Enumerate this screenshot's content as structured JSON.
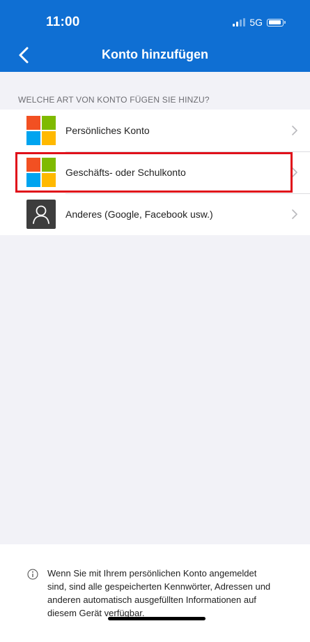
{
  "status_bar": {
    "time": "11:00",
    "network": "5G"
  },
  "nav": {
    "title": "Konto hinzufügen"
  },
  "section": {
    "header": "WELCHE ART VON KONTO FÜGEN SIE HINZU?"
  },
  "accounts": [
    {
      "label": "Persönliches Konto",
      "icon": "microsoft-logo"
    },
    {
      "label": "Geschäfts- oder Schulkonto",
      "icon": "microsoft-logo"
    },
    {
      "label": "Anderes (Google, Facebook usw.)",
      "icon": "person-icon"
    }
  ],
  "footer": {
    "info_text": "Wenn Sie mit Ihrem persönlichen Konto angemeldet sind, sind alle gespeicherten Kennwörter, Adressen und anderen automatisch ausgefüllten Informationen auf diesem Gerät verfügbar."
  },
  "colors": {
    "header_bg": "#0f6fd3",
    "highlight": "#e0101a",
    "ms_red": "#f25022",
    "ms_green": "#7fba00",
    "ms_blue": "#00a4ef",
    "ms_yellow": "#ffb900"
  }
}
